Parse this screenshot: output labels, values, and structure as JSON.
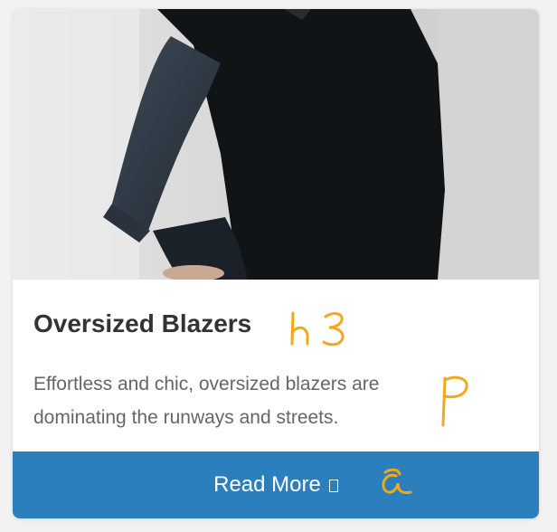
{
  "card": {
    "image_alt": "Person in black oversized blazer and jeans sitting by a window",
    "title": "Oversized Blazers",
    "description": "Effortless and chic, oversized blazers are dominating the runways and streets.",
    "button_label": "Read More",
    "button_icon": "arrow-right-icon"
  },
  "annotations": {
    "title_tag": "h3",
    "desc_tag": "P",
    "button_tag": "a",
    "color": "#f2a81d"
  },
  "colors": {
    "button_bg": "#2b7fbd",
    "title": "#333333",
    "text": "#666666"
  }
}
